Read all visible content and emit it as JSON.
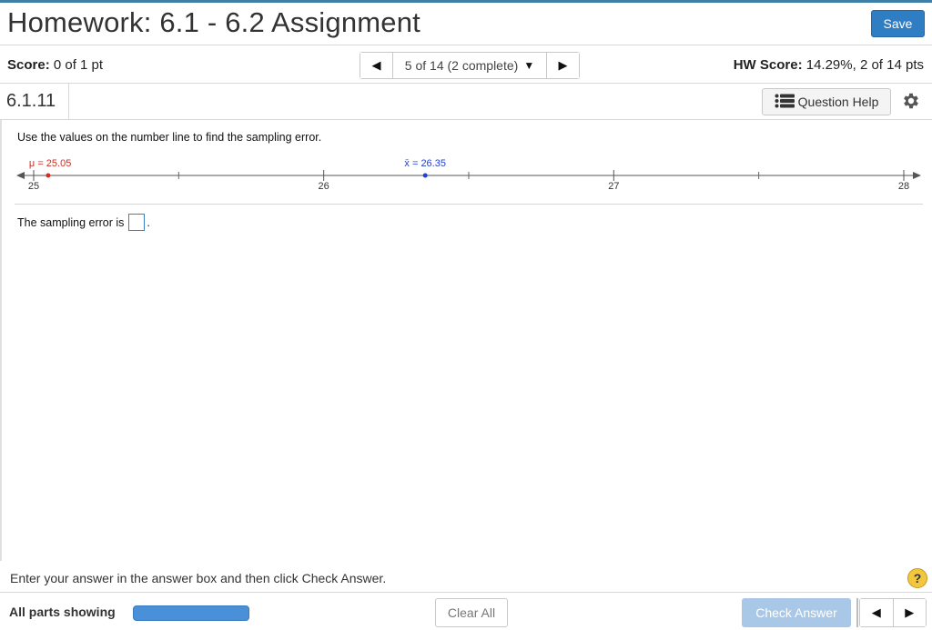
{
  "header": {
    "title": "Homework: 6.1 - 6.2 Assignment",
    "save_label": "Save"
  },
  "score": {
    "label": "Score:",
    "value": "0 of 1 pt",
    "hw_label": "HW Score:",
    "hw_value": "14.29%, 2 of 14 pts"
  },
  "question_nav": {
    "current": "5 of 14 (2 complete)",
    "prev_icon": "triangle-left-icon",
    "next_icon": "triangle-right-icon",
    "caret_icon": "caret-down-icon"
  },
  "question": {
    "id": "6.1.11",
    "help_label": "Question Help",
    "prompt": "Use the values on the number line to find the sampling error.",
    "answer_prefix": "The sampling error is",
    "answer_suffix": "."
  },
  "number_line": {
    "min": 25,
    "max": 28,
    "major_ticks": [
      25,
      26,
      27,
      28
    ],
    "minor_ticks": [
      25.5,
      26.5,
      27.5
    ],
    "mu_label": "μ = 25.05",
    "mu_value": 25.05,
    "mu_color": "#d62b1f",
    "xbar_label": "x̄ = 26.35",
    "xbar_value": 26.35,
    "xbar_color": "#1f3fd6"
  },
  "instruction": "Enter your answer in the answer box and then click Check Answer.",
  "footer": {
    "parts_label": "All parts showing",
    "clear_label": "Clear All",
    "check_label": "Check Answer"
  },
  "colors": {
    "primary": "#2f7ec4",
    "check_disabled": "#a9c8e8",
    "help_yellow": "#f3c640"
  }
}
